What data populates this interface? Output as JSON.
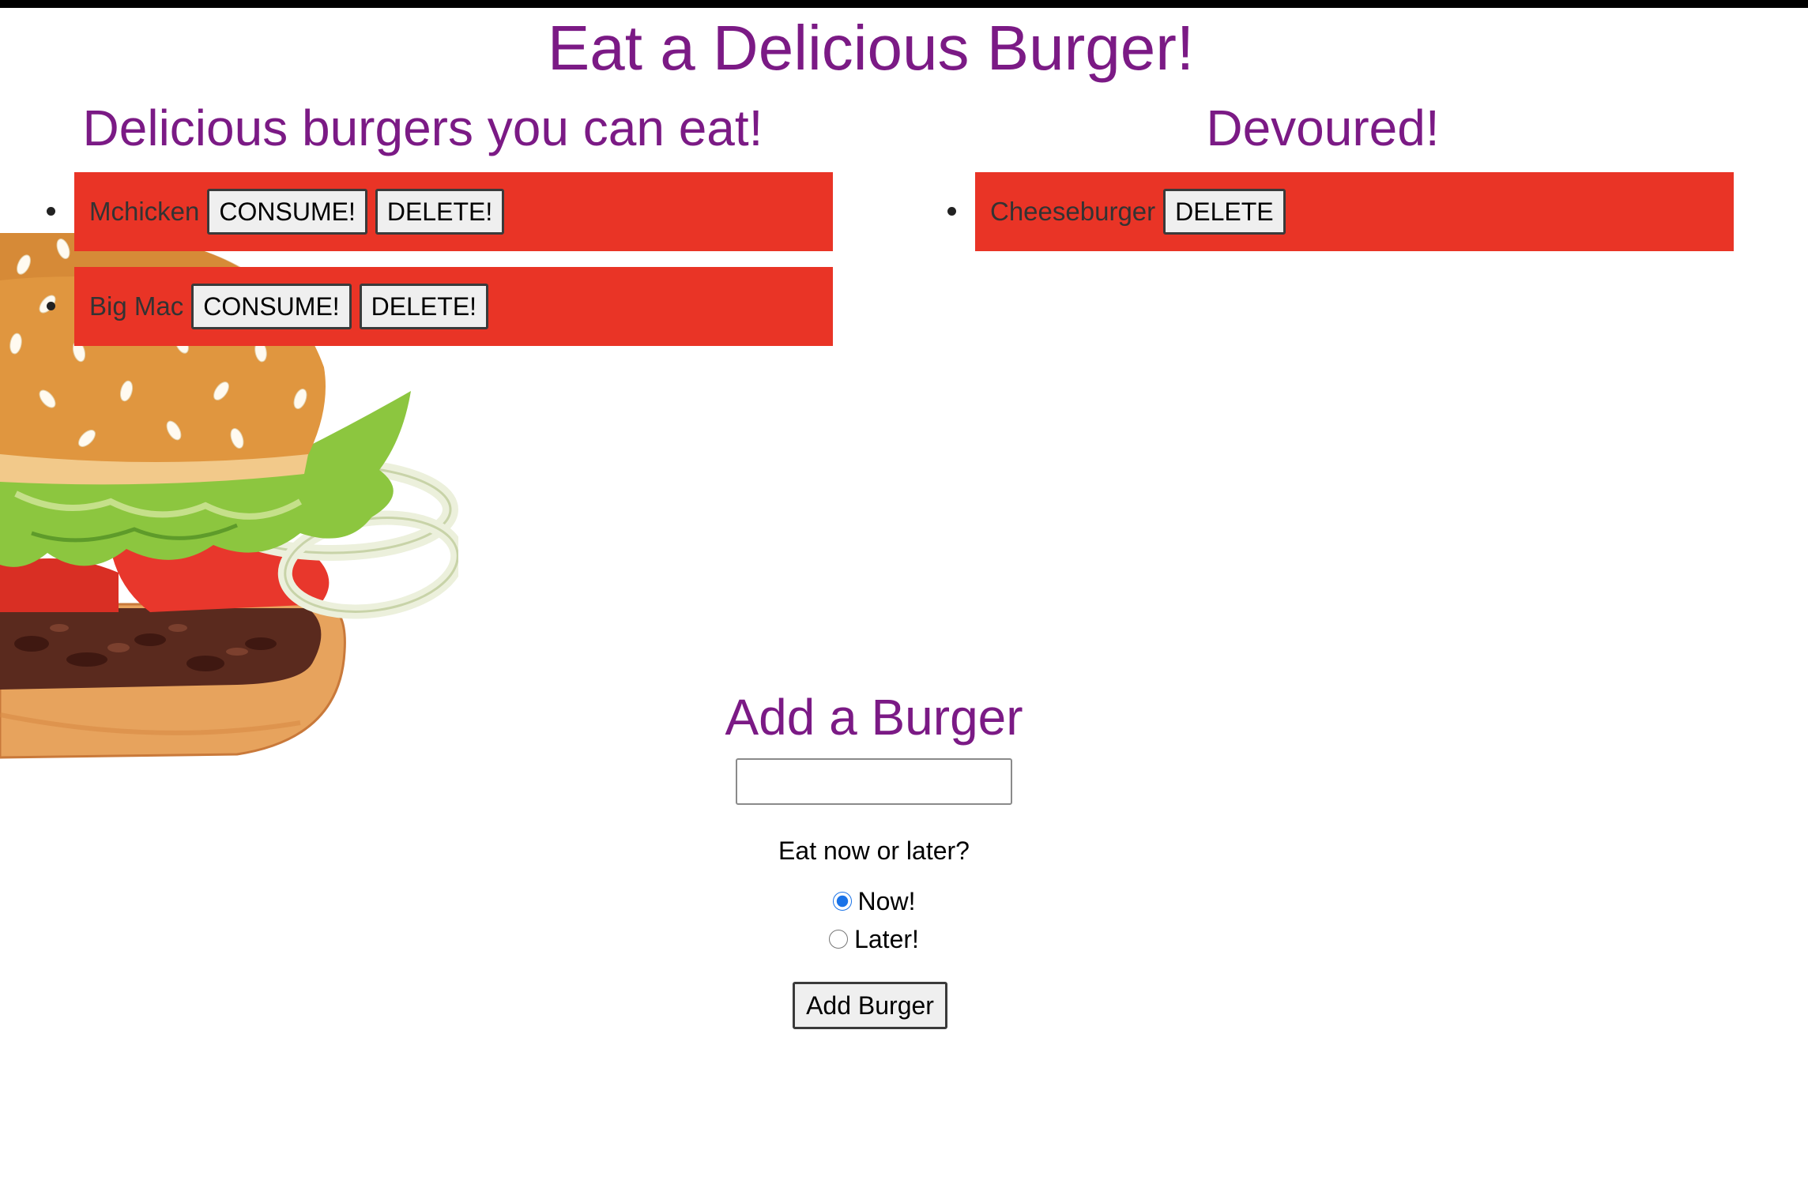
{
  "page": {
    "title": "Eat a Delicious Burger!"
  },
  "available": {
    "heading": "Delicious burgers you can eat!",
    "items": [
      {
        "name": "Mchicken",
        "consume_label": "CONSUME!",
        "delete_label": "DELETE!"
      },
      {
        "name": "Big Mac",
        "consume_label": "CONSUME!",
        "delete_label": "DELETE!"
      }
    ]
  },
  "devoured": {
    "heading": "Devoured!",
    "items": [
      {
        "name": "Cheeseburger",
        "delete_label": "DELETE"
      }
    ]
  },
  "add_form": {
    "heading": "Add a Burger",
    "input_value": "",
    "question": "Eat now or later?",
    "options": [
      {
        "label": "Now!",
        "checked": true
      },
      {
        "label": "Later!",
        "checked": false
      }
    ],
    "submit_label": "Add Burger"
  },
  "colors": {
    "heading": "#7b1a85",
    "item_background": "#e93426",
    "item_text": "#333333",
    "topbar": "#000000",
    "radio_accent": "#1a73e8"
  },
  "icons": {
    "background_illustration": "burger-illustration"
  }
}
